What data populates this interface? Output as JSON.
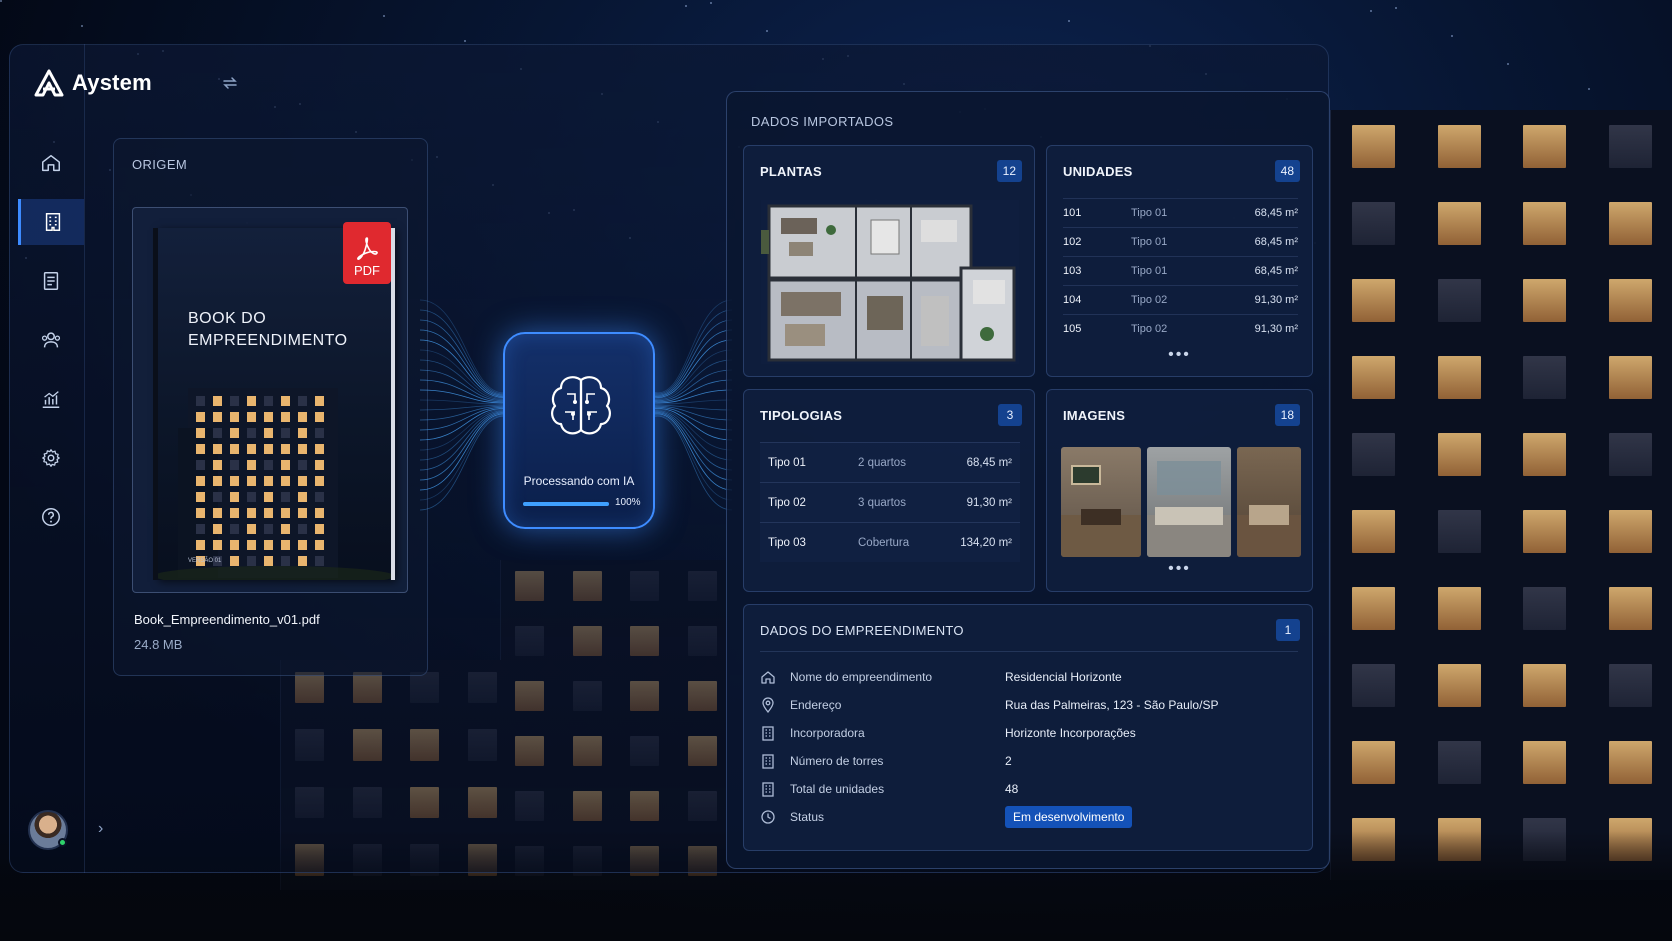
{
  "brand": {
    "name": "Aystem"
  },
  "nav": {
    "items": [
      {
        "icon": "home-icon",
        "active": false
      },
      {
        "icon": "building-icon",
        "active": true
      },
      {
        "icon": "document-icon",
        "active": false
      },
      {
        "icon": "users-icon",
        "active": false
      },
      {
        "icon": "chart-icon",
        "active": false
      },
      {
        "icon": "gear-icon",
        "active": false
      },
      {
        "icon": "help-icon",
        "active": false
      }
    ]
  },
  "origin": {
    "label": "ORIGEM",
    "book_title_line1": "BOOK DO",
    "book_title_line2": "EMPREENDIMENTO",
    "book_version": "VERSÃO 01",
    "pdf_badge": "PDF",
    "file_name": "Book_Empreendimento_v01.pdf",
    "file_size": "24.8 MB"
  },
  "ai": {
    "label": "Processando com IA",
    "progress_text": "100%",
    "progress": 1.0
  },
  "imported": {
    "label": "DADOS IMPORTADOS",
    "plantas": {
      "title": "PLANTAS",
      "count": "12"
    },
    "unidades": {
      "title": "UNIDADES",
      "count": "48",
      "rows": [
        {
          "unit": "101",
          "type": "Tipo 01",
          "area": "68,45 m²"
        },
        {
          "unit": "102",
          "type": "Tipo 01",
          "area": "68,45 m²"
        },
        {
          "unit": "103",
          "type": "Tipo 01",
          "area": "68,45 m²"
        },
        {
          "unit": "104",
          "type": "Tipo 02",
          "area": "91,30 m²"
        },
        {
          "unit": "105",
          "type": "Tipo 02",
          "area": "91,30 m²"
        }
      ],
      "more": "•••"
    },
    "tipologias": {
      "title": "TIPOLOGIAS",
      "count": "3",
      "rows": [
        {
          "name": "Tipo 01",
          "desc": "2 quartos",
          "area": "68,45 m²"
        },
        {
          "name": "Tipo 02",
          "desc": "3 quartos",
          "area": "91,30 m²"
        },
        {
          "name": "Tipo 03",
          "desc": "Cobertura",
          "area": "134,20 m²"
        }
      ]
    },
    "imagens": {
      "title": "IMAGENS",
      "count": "18",
      "more": "•••"
    },
    "dados": {
      "title": "DADOS DO EMPREENDIMENTO",
      "count": "1",
      "rows": [
        {
          "icon": "home-icon",
          "key": "Nome do empreendimento",
          "value": "Residencial Horizonte"
        },
        {
          "icon": "location-pin-icon",
          "key": "Endereço",
          "value": "Rua das Palmeiras, 123 - São Paulo/SP"
        },
        {
          "icon": "building-icon",
          "key": "Incorporadora",
          "value": "Horizonte Incorporações"
        },
        {
          "icon": "building-icon",
          "key": "Número de torres",
          "value": "2"
        },
        {
          "icon": "building-icon",
          "key": "Total de unidades",
          "value": "48"
        },
        {
          "icon": "clock-icon",
          "key": "Status",
          "value": "Em desenvolvimento"
        }
      ]
    }
  },
  "colors": {
    "accent": "#3d8bff",
    "badge": "#14428f",
    "status": "#1452b8",
    "pdf": "#e0292f"
  }
}
